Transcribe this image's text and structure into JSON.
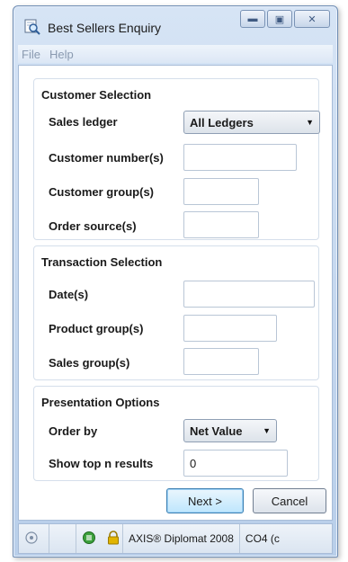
{
  "window": {
    "title": "Best Sellers Enquiry"
  },
  "menu": {
    "items": [
      "File",
      "Help"
    ]
  },
  "customer_selection": {
    "title": "Customer Selection",
    "sales_ledger_label": "Sales ledger",
    "sales_ledger_value": "All Ledgers",
    "customer_numbers_label": "Customer number(s)",
    "customer_numbers_value": "",
    "customer_groups_label": "Customer group(s)",
    "customer_groups_value": "",
    "order_sources_label": "Order source(s)",
    "order_sources_value": ""
  },
  "transaction_selection": {
    "title": "Transaction Selection",
    "dates_label": "Date(s)",
    "dates_value": "",
    "product_groups_label": "Product group(s)",
    "product_groups_value": "",
    "sales_groups_label": "Sales group(s)",
    "sales_groups_value": ""
  },
  "presentation_options": {
    "title": "Presentation Options",
    "order_by_label": "Order by",
    "order_by_value": "Net Value",
    "top_n_label": "Show top n results",
    "top_n_value": "0"
  },
  "buttons": {
    "next": "Next >",
    "cancel": "Cancel"
  },
  "statusbar": {
    "product": "AXIS® Diplomat 2008",
    "company": "CO4 (c"
  },
  "colors": {
    "window_frame": "#c3d6ee",
    "default_button": "#bee6fd",
    "status_icon_green": "#3ca03c",
    "status_icon_yellow": "#e1b400"
  }
}
